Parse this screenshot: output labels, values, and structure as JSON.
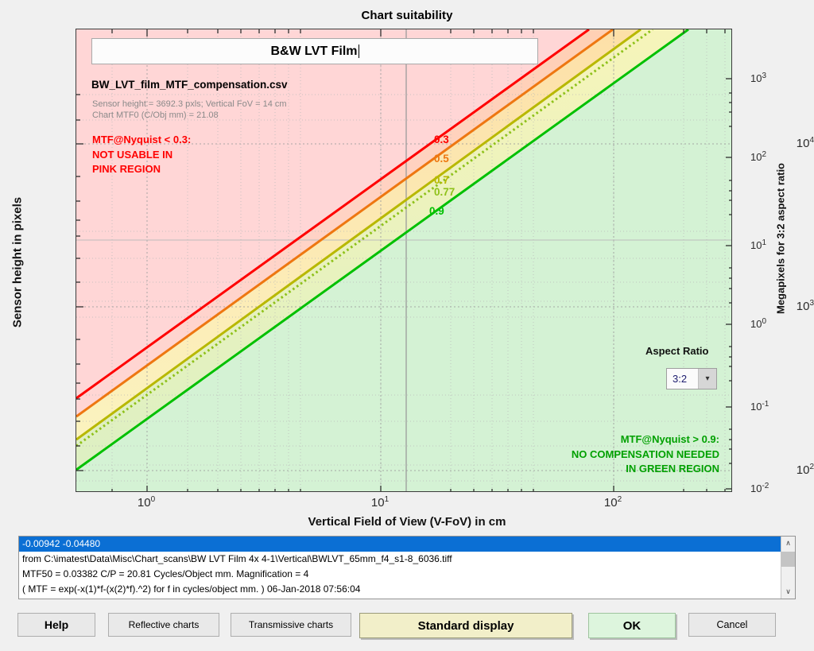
{
  "window": {
    "figure_title": "Chart suitability"
  },
  "plot": {
    "title_input_value": "B&W LVT Film",
    "csv_filename": "BW_LVT_film_MTF_compensation.csv",
    "info_line_1": "Sensor height = 3692.3 pxls;   Vertical FoV = 14 cm",
    "info_line_2": "Chart MTF0 (C/Obj mm) = 21.08",
    "pink_note_lines": [
      "MTF@Nyquist < 0.3:",
      "NOT USABLE IN",
      "PINK REGION"
    ],
    "green_note_lines": [
      "MTF@Nyquist > 0.9:",
      "NO COMPENSATION NEEDED",
      "IN GREEN REGION"
    ],
    "aspect_ratio_label": "Aspect Ratio",
    "aspect_ratio_value": "3:2",
    "aspect_ratio_options": [
      "3:2"
    ],
    "colors": {
      "curve_0_3": "#ff0000",
      "curve_0_5": "#ee7711",
      "curve_0_7": "#b8b800",
      "curve_0_77": "#8ec11a",
      "curve_0_9": "#00c000",
      "pink_region": "#ffd6d6",
      "green_region": "#d4f2d4",
      "note_red": "#ff0000",
      "note_green": "#00a000"
    }
  },
  "chart_data": {
    "type": "line",
    "title": "Chart suitability",
    "xlabel": "Vertical Field of View (V-FoV) in cm",
    "ylabel": "Sensor height in pixels",
    "y2label": "Megapixels for 3:2 aspect ratio",
    "xscale": "log",
    "yscale": "log",
    "xlim": [
      0.5,
      400
    ],
    "ylim": [
      90,
      22000
    ],
    "y2lim": [
      0.01,
      3000
    ],
    "grid": true,
    "legend": "inline-curve-labels",
    "xticks": [
      "10<sup>0</sup>",
      "10<sup>1</sup>",
      "10<sup>2</sup>"
    ],
    "xtick_values": [
      1,
      10,
      100
    ],
    "yticks": [
      "10<sup>2</sup>",
      "10<sup>3</sup>",
      "10<sup>4</sup>"
    ],
    "ytick_values": [
      100,
      1000,
      10000
    ],
    "y2ticks": [
      "10<sup>-2</sup>",
      "10<sup>-1</sup>",
      "10<sup>0</sup>",
      "10<sup>1</sup>",
      "10<sup>2</sup>",
      "10<sup>3</sup>"
    ],
    "y2tick_values": [
      0.01,
      0.1,
      1,
      10,
      100,
      1000
    ],
    "marker_vfov_cm": 14,
    "marker_sensor_height_px": 3692.3,
    "series": [
      {
        "name": "0.3",
        "label": "0.3",
        "color": "#ff0000",
        "style": "solid",
        "x": [
          0.5,
          400
        ],
        "y": [
          222,
          177000
        ]
      },
      {
        "name": "0.5",
        "label": "0.5",
        "color": "#ee7711",
        "style": "solid",
        "x": [
          0.5,
          400
        ],
        "y": [
          169,
          135000
        ]
      },
      {
        "name": "0.7",
        "label": "0.7",
        "color": "#b8b800",
        "style": "solid",
        "x": [
          0.5,
          400
        ],
        "y": [
          124,
          99000
        ]
      },
      {
        "name": "0.77",
        "label": "0.77",
        "color": "#8ec11a",
        "style": "dotted",
        "x": [
          0.5,
          400
        ],
        "y": [
          115,
          92000
        ]
      },
      {
        "name": "0.9",
        "label": "0.9",
        "color": "#00c000",
        "style": "solid",
        "x": [
          0.5,
          400
        ],
        "y": [
          96,
          69000
        ]
      }
    ],
    "curve_labels": [
      {
        "text": "0.3",
        "color": "#ff0000"
      },
      {
        "text": "0.5",
        "color": "#ee7711"
      },
      {
        "text": "0.7",
        "color": "#b8b800"
      },
      {
        "text": "0.77",
        "color": "#8ec11a"
      },
      {
        "text": "0.9",
        "color": "#00c000"
      }
    ]
  },
  "text_output": {
    "lines": [
      "-0.00942  -0.04480",
      "from  C:\\imatest\\Data\\Misc\\Chart_scans\\BW LVT Film 4x 4-1\\Vertical\\BWLVT_65mm_f4_s1-8_6036.tiff",
      "MTF50 = 0.03382 C/P  = 20.81 Cycles/Object mm.  Magnification = 4",
      "( MTF = exp(-x(1)*f-(x(2)*f).^2) for f in cycles/object mm. )  06-Jan-2018 07:56:04"
    ],
    "selected_index": 0,
    "scroll_up_glyph": "∧",
    "scroll_down_glyph": "∨"
  },
  "buttons": {
    "help": "Help",
    "reflective": "Reflective charts",
    "transmissive": "Transmissive charts",
    "standard_display": "Standard display",
    "ok": "OK",
    "cancel": "Cancel"
  }
}
